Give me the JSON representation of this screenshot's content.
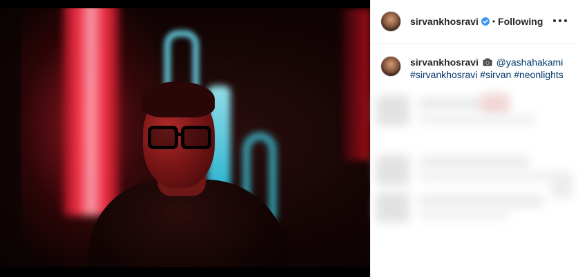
{
  "post": {
    "username": "sirvankhosravi",
    "separator": "•",
    "follow_status": "Following",
    "caption": {
      "username": "sirvankhosravi",
      "mention": "@yashahakami",
      "hashtags": [
        "#sirvankhosravi",
        "#sirvan",
        "#neonlights"
      ]
    }
  },
  "icons": {
    "verified": "verified-badge-icon",
    "more": "more-options-icon",
    "camera": "camera-icon"
  },
  "colors": {
    "verified_blue": "#3897f0",
    "link": "#00376b",
    "text": "#262626",
    "neon_red": "#ff3a4f",
    "neon_cyan": "#6fe8ff"
  }
}
